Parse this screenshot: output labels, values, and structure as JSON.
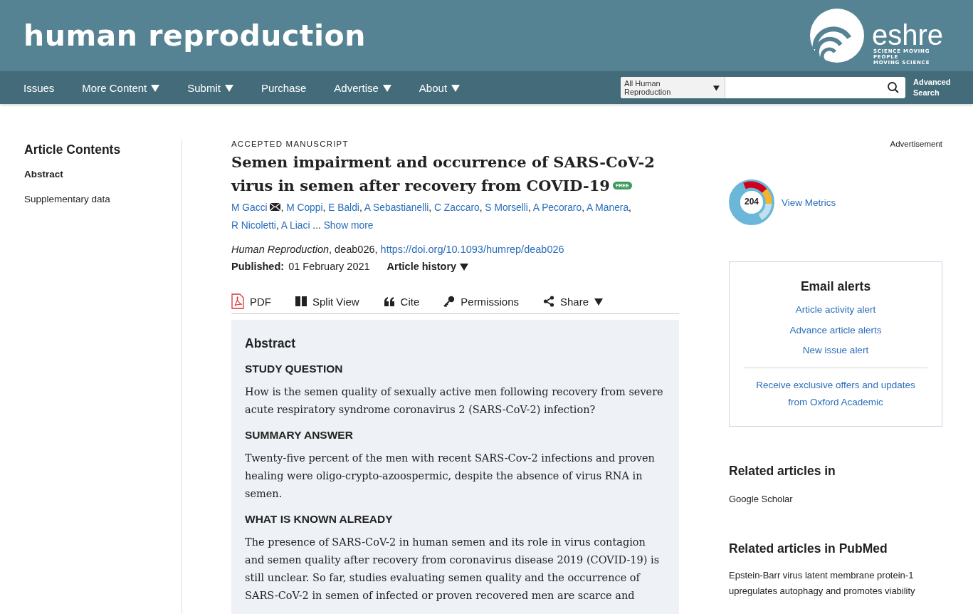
{
  "header": {
    "title": "human reproduction",
    "logo": {
      "name": "eshre",
      "tagline": [
        "SCIENCE MOVING",
        "PEOPLE",
        "MOVING SCIENCE"
      ]
    }
  },
  "nav": {
    "items": [
      {
        "label": "Issues",
        "has_menu": false
      },
      {
        "label": "More Content",
        "has_menu": true
      },
      {
        "label": "Submit",
        "has_menu": true
      },
      {
        "label": "Purchase",
        "has_menu": false
      },
      {
        "label": "Advertise",
        "has_menu": true
      },
      {
        "label": "About",
        "has_menu": true
      }
    ],
    "search": {
      "scope": "All Human Reproduction",
      "advanced": "Advanced Search"
    }
  },
  "sidebar": {
    "title": "Article Contents",
    "items": [
      {
        "label": "Abstract",
        "selected": true
      },
      {
        "label": "Supplementary data",
        "selected": false
      }
    ]
  },
  "article": {
    "status": "ACCEPTED MANUSCRIPT",
    "title": "Semen impairment and occurrence of SARS-CoV-2 virus in semen after recovery from COVID-19",
    "free_badge": "FREE",
    "authors": [
      {
        "name": "M Gacci",
        "email": true
      },
      {
        "name": "M Coppi",
        "email": false
      },
      {
        "name": "E Baldi",
        "email": false
      },
      {
        "name": "A Sebastianelli",
        "email": false
      },
      {
        "name": "C Zaccaro",
        "email": false
      },
      {
        "name": "S Morselli",
        "email": false
      },
      {
        "name": "A Pecoraro",
        "email": false
      },
      {
        "name": "A Manera",
        "email": false
      },
      {
        "name": "R Nicoletti",
        "email": false
      },
      {
        "name": "A Liaci",
        "email": false
      }
    ],
    "author_separator": ",",
    "ellipsis": "...",
    "show_more": "Show more",
    "citation": {
      "journal": "Human Reproduction",
      "details": ", deab026,",
      "doi": "https://doi.org/10.1093/humrep/deab026"
    },
    "published": {
      "label": "Published:",
      "date": "01 February 2021"
    },
    "history": {
      "label": "Article history",
      "has_menu": true
    },
    "tools": [
      {
        "kind": "pdf",
        "label": "PDF",
        "has_menu": false
      },
      {
        "kind": "split",
        "label": "Split View",
        "has_menu": false
      },
      {
        "kind": "cite",
        "label": "Cite",
        "has_menu": false
      },
      {
        "kind": "permissions",
        "label": "Permissions",
        "has_menu": false
      },
      {
        "kind": "share",
        "label": "Share",
        "has_menu": true
      }
    ],
    "abstract": {
      "title": "Abstract",
      "sections": [
        {
          "heading": "STUDY QUESTION",
          "text": "How is the semen quality of sexually active men following recovery from severe acute respiratory syndrome coronavirus 2 (SARS-CoV-2) infection?"
        },
        {
          "heading": "SUMMARY ANSWER",
          "text": "Twenty-five percent of the men with recent SARS-Cov-2 infections and proven healing were oligo-crypto-azoospermic, despite the absence of virus RNA in semen."
        },
        {
          "heading": "WHAT IS KNOWN ALREADY",
          "text": "The presence of SARS-CoV-2 in human semen and its role in virus contagion and semen quality after recovery from coronavirus disease 2019 (COVID-19) is still unclear. So far, studies evaluating semen quality and the occurrence of SARS-CoV-2 in semen of infected or proven recovered men are scarce and"
        }
      ]
    }
  },
  "rail": {
    "advertisement": "Advertisement",
    "metrics": {
      "score": "204",
      "link": "View Metrics"
    },
    "alerts": {
      "title": "Email alerts",
      "links": [
        "Article activity alert",
        "Advance article alerts",
        "New issue alert"
      ],
      "offer": "Receive exclusive offers and updates from Oxford Academic"
    },
    "related": [
      {
        "title": "Related articles in",
        "items": [
          "Google Scholar"
        ]
      },
      {
        "title": "Related articles in PubMed",
        "items": [
          "Epstein-Barr virus latent membrane protein-1 upregulates autophagy and promotes viability"
        ]
      }
    ]
  }
}
